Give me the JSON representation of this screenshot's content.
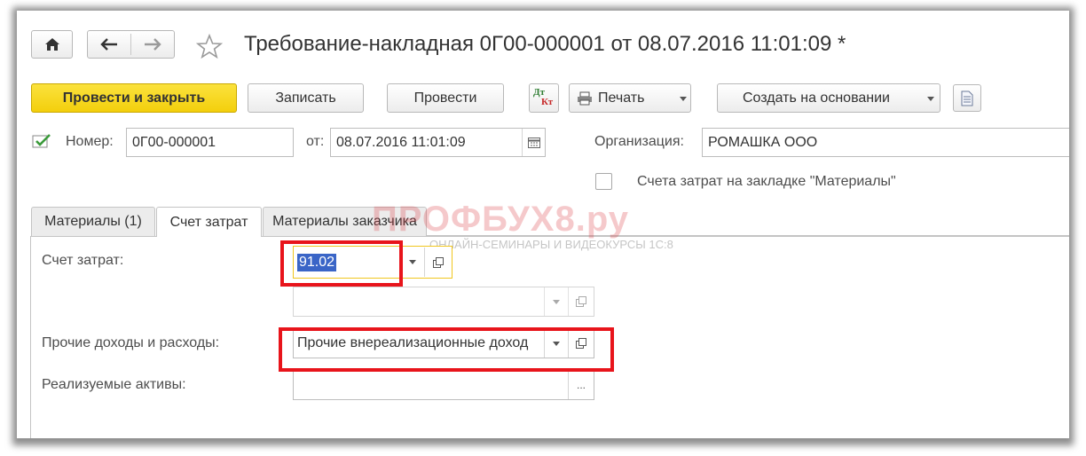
{
  "header": {
    "title": "Требование-накладная 0Г00-000001 от 08.07.2016 11:01:09 *",
    "home_icon": "home-icon",
    "back_icon": "arrow-left-icon",
    "forward_icon": "arrow-right-icon",
    "favorite_icon": "star-icon"
  },
  "toolbar": {
    "post_close_label": "Провести и закрыть",
    "save_label": "Записать",
    "post_label": "Провести",
    "dtkt_icon": "dt-kt-icon",
    "dt_text": "Дт",
    "kt_text": "Кт",
    "print_label": "Печать",
    "create_based_label": "Создать на основании",
    "report_icon": "report-icon"
  },
  "form": {
    "number_label": "Номер:",
    "number_value": "0Г00-000001",
    "date_label": "от:",
    "date_value": "08.07.2016 11:01:09",
    "org_label": "Организация:",
    "org_value": "РОМАШКА ООО",
    "cost_accounts_checkbox_label": "Счета затрат на закладке \"Материалы\""
  },
  "tabs": [
    {
      "label": "Материалы (1)"
    },
    {
      "label": "Счет затрат"
    },
    {
      "label": "Материалы заказчика"
    }
  ],
  "panel": {
    "cost_account_label": "Счет затрат:",
    "cost_account_value": "91.02",
    "subconto_value": "",
    "other_income_label": "Прочие доходы и расходы:",
    "other_income_value": "Прочие внереализационные доход",
    "sold_assets_label": "Реализуемые активы:",
    "sold_assets_value": "",
    "ellipsis": "..."
  },
  "watermark": {
    "brand": "ПРОФБУХ8.ру",
    "tagline": "ОНЛАЙН-СЕМИНАРЫ И ВИДЕОКУРСЫ 1С:8"
  },
  "colors": {
    "primary_button": "#f3cf0c",
    "highlight_red": "#e8141b",
    "selection_blue": "#3a65c7",
    "focus_yellow": "#f0c61e"
  }
}
